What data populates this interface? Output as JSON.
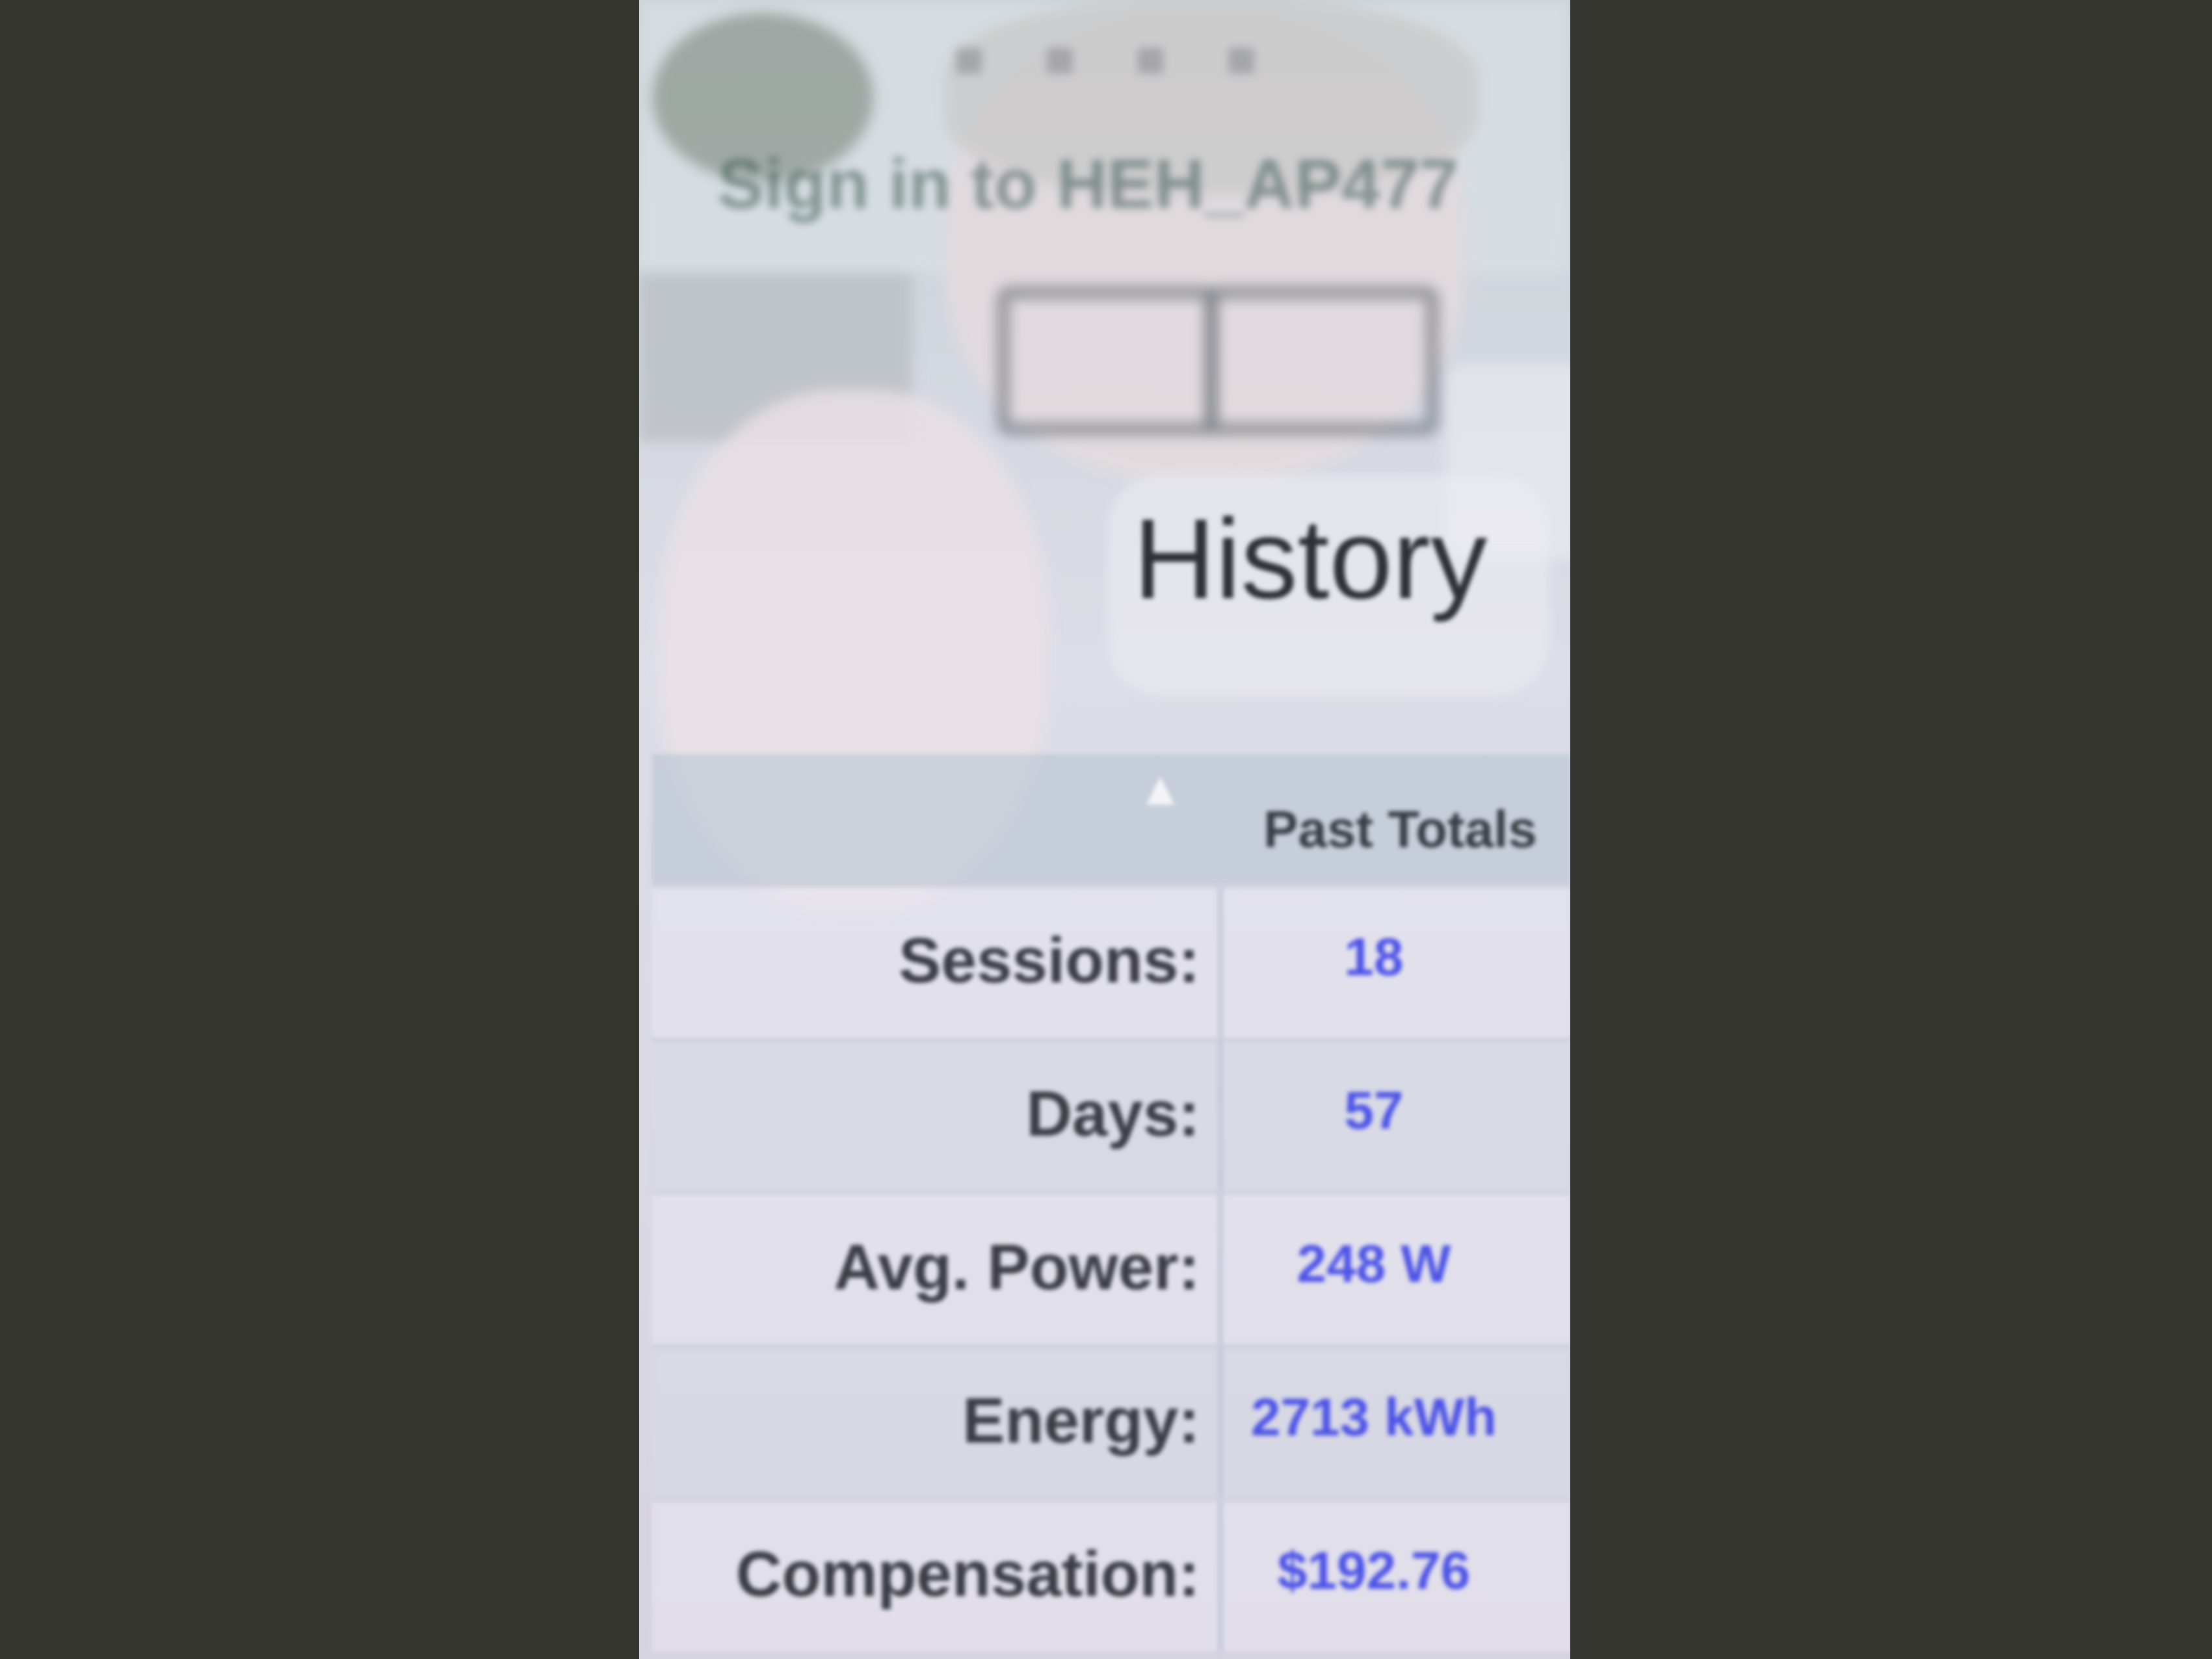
{
  "notification": {
    "signin_text": "Sign in to HEH_AP477",
    "status_icons": ""
  },
  "history": {
    "title": "History",
    "column_header": "Past Totals",
    "rows": [
      {
        "label": "Sessions:",
        "value": "18"
      },
      {
        "label": "Days:",
        "value": "57"
      },
      {
        "label": "Avg. Power:",
        "value": "248 W"
      },
      {
        "label": "Energy:",
        "value": "2713 kWh"
      },
      {
        "label": "Compensation:",
        "value": "$192.76"
      }
    ]
  },
  "colors": {
    "background": "#34352f",
    "value_text": "#4b52e6",
    "label_text": "#3b3c44"
  },
  "icons": [
    "sort-up-icon"
  ]
}
